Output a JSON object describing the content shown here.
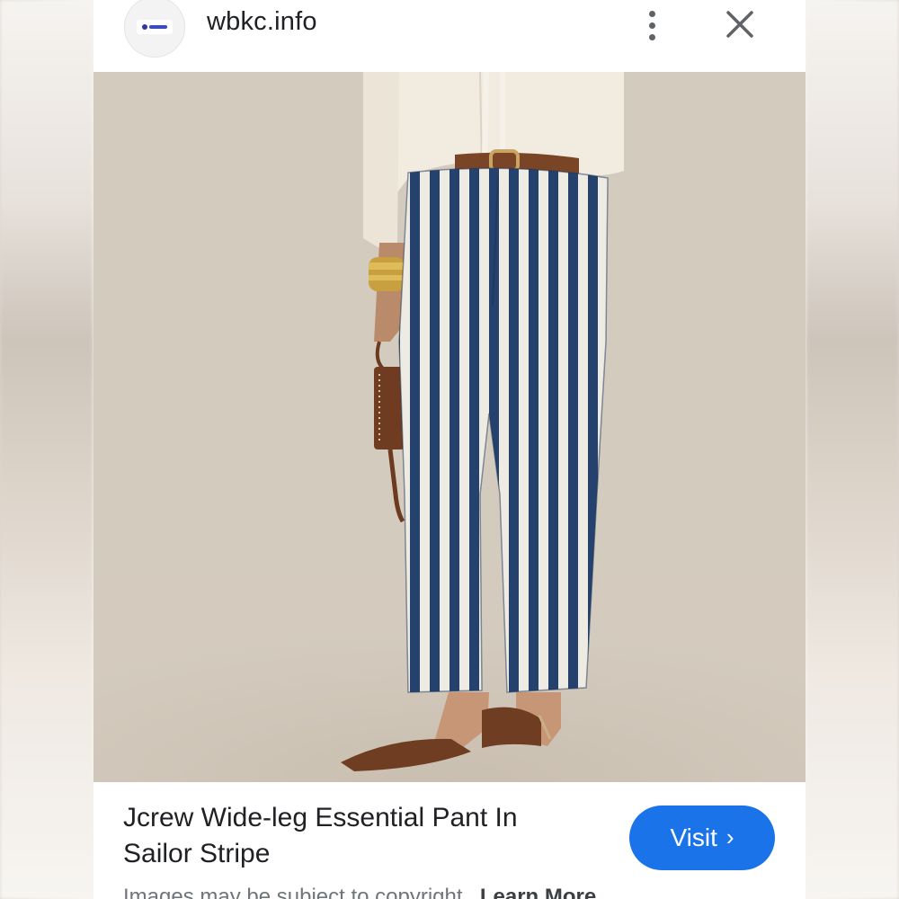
{
  "header": {
    "site_name": "wbkc.info",
    "logo_icon": "wbkc-logo-icon",
    "menu_icon": "more-vert-icon",
    "close_icon": "close-icon"
  },
  "image": {
    "description_icon": "product-photo"
  },
  "caption": {
    "title": "Jcrew Wide-leg Essential Pant In Sailor Stripe"
  },
  "visit_button": {
    "label": "Visit",
    "icon": "chevron-right-icon",
    "color": "#1a73e8"
  },
  "footer": {
    "copyright_text": "Images may be subject to copyright.",
    "learn_more": "Learn More"
  }
}
